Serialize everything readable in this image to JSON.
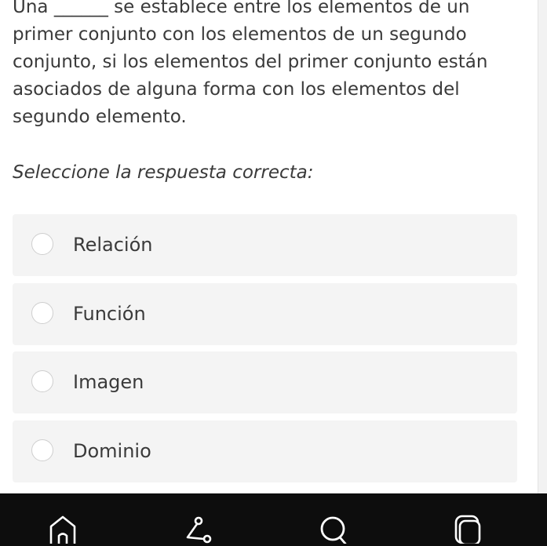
{
  "question": {
    "text": "Una ______ se establece entre los elementos de un primer conjunto con los elementos de un segundo conjunto, si los elementos del primer conjunto están asociados de alguna forma con los elementos del segundo elemento.",
    "instruction": "Seleccione la respuesta correcta:"
  },
  "options": [
    {
      "label": "Relación",
      "selected": false
    },
    {
      "label": "Función",
      "selected": false
    },
    {
      "label": "Imagen",
      "selected": false
    },
    {
      "label": "Dominio",
      "selected": false
    }
  ],
  "bottom_nav": [
    {
      "icon": "home-icon"
    },
    {
      "icon": "graph-icon"
    },
    {
      "icon": "search-icon"
    },
    {
      "icon": "copy-icon"
    }
  ],
  "colors": {
    "text": "#3a3a3a",
    "option_background": "#f4f4f4",
    "radio_border": "#cfcfcf",
    "nav_background": "#0d0d0d",
    "nav_icon": "#ffffff"
  }
}
